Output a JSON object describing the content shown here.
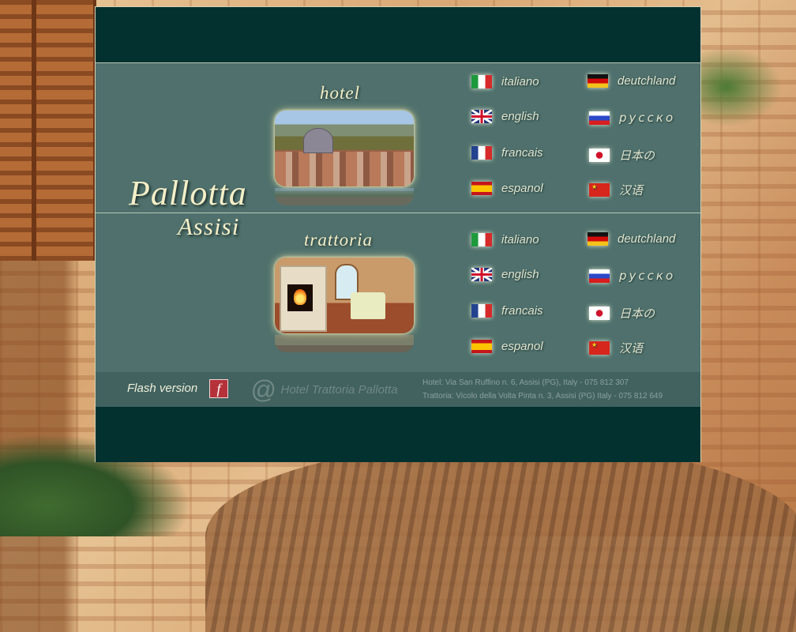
{
  "brand": {
    "name": "Pallotta",
    "town": "Assisi"
  },
  "sections": {
    "hotel": {
      "title": "hotel",
      "languages": [
        "italiano",
        "deutchland",
        "english",
        "русско",
        "francais",
        "日本の",
        "espanol",
        "汉语"
      ]
    },
    "trattoria": {
      "title": "trattoria",
      "languages": [
        "italiano",
        "deutchland",
        "english",
        "русско",
        "francais",
        "日本の",
        "espanol",
        "汉语"
      ]
    }
  },
  "footer": {
    "flash_label": "Flash version",
    "flash_icon_glyph": "f",
    "contact_at": "@",
    "contact_name": "Hotel Trattoria Pallotta",
    "address_hotel": "Hotel: Via San Ruffino n. 6, Assisi (PG), Italy - 075 812 307",
    "address_trattoria": "Trattoria: Vicolo della Volta Pinta n. 3, Assisi (PG) Italy - 075 812 649"
  },
  "colors": {
    "panel": "#4f706c",
    "band": "#033130",
    "title_text": "#f4efc8"
  },
  "icons": {
    "flags": [
      "italy-flag-icon",
      "germany-flag-icon",
      "uk-flag-icon",
      "russia-flag-icon",
      "france-flag-icon",
      "japan-flag-icon",
      "spain-flag-icon",
      "china-flag-icon"
    ],
    "flash": "flash-player-icon",
    "at": "at-sign-icon"
  }
}
